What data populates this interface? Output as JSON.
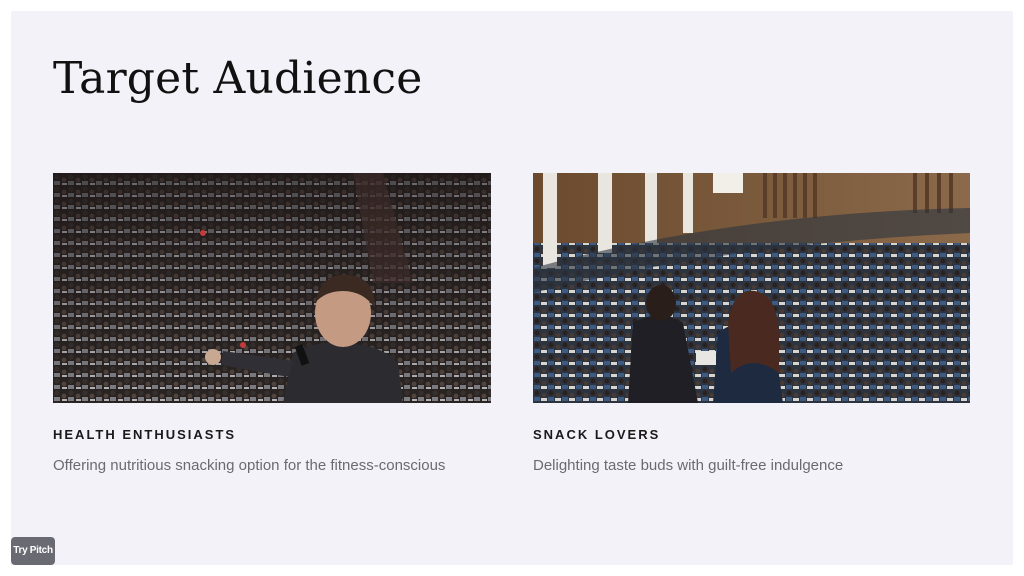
{
  "slide": {
    "title": "Target Audience",
    "background_color": "#f3f2f8"
  },
  "cards": [
    {
      "heading": "HEALTH ENTHUSIASTS",
      "description": "Offering nutritious snacking option for the fitness-conscious",
      "image": "photo-speaker-addressing-large-audience"
    },
    {
      "heading": "SNACK LOVERS",
      "description": "Delighting taste buds with guilt-free indulgence",
      "image": "photo-two-presenters-facing-auditorium"
    }
  ],
  "badge": {
    "label": "Try Pitch"
  }
}
